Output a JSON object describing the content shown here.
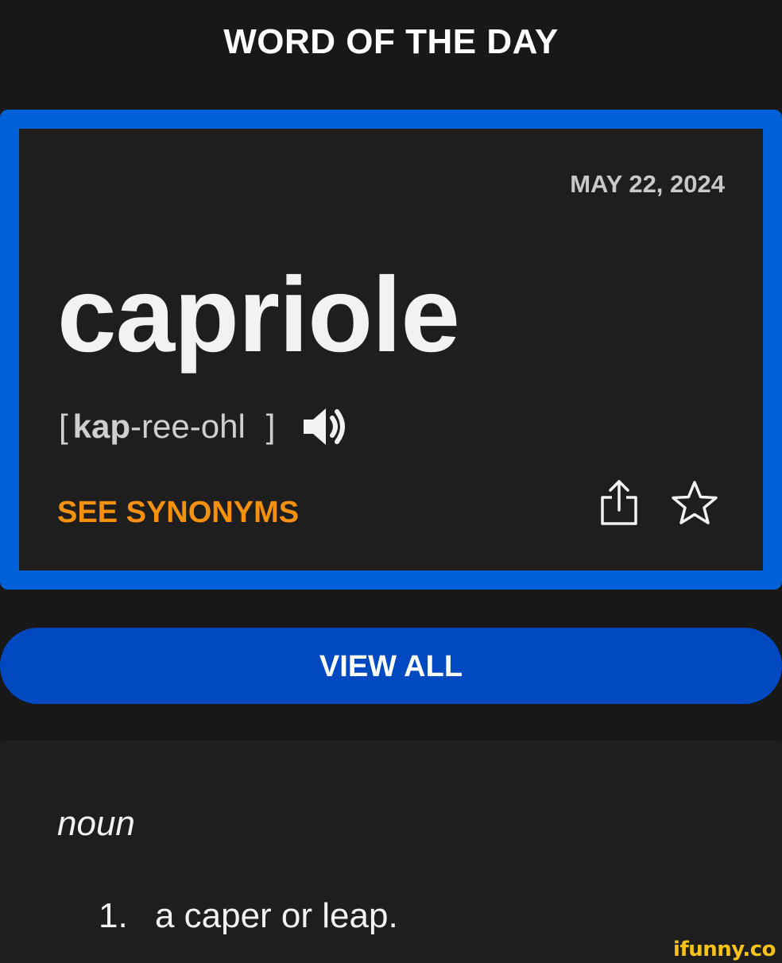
{
  "header": {
    "title": "WORD OF THE DAY"
  },
  "card": {
    "date": "MAY 22, 2024",
    "word": "capriole",
    "pronunciation": {
      "open": "[",
      "stressed": "kap",
      "rest": "-ree-ohl",
      "close": "]"
    },
    "synonyms_label": "SEE SYNONYMS",
    "icons": [
      "speaker-icon",
      "share-icon",
      "star-icon"
    ]
  },
  "actions": {
    "view_all_label": "VIEW ALL"
  },
  "definition": {
    "part_of_speech": "noun",
    "items": [
      {
        "number": "1.",
        "text": "a caper or leap."
      }
    ]
  },
  "watermark": "ifunny.co",
  "colors": {
    "background": "#181818",
    "card_border": "#0060d8",
    "button": "#0049c0",
    "synonyms": "#f5910e",
    "watermark": "#f7c21a"
  }
}
